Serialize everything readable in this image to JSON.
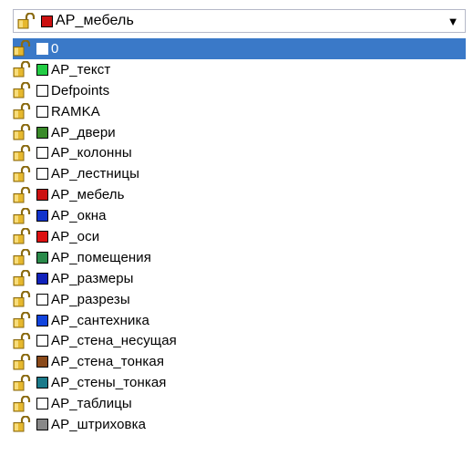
{
  "combo": {
    "selected_label": "AP_мебель",
    "selected_color": "#cc1111",
    "arrow_glyph": "▼"
  },
  "layers": [
    {
      "label": "0",
      "color": "#ffffff",
      "selected": true
    },
    {
      "label": "AP_текст",
      "color": "#22cc44"
    },
    {
      "label": "Defpoints",
      "color": "#ffffff"
    },
    {
      "label": "RAMKA",
      "color": "#ffffff"
    },
    {
      "label": "AP_двери",
      "color": "#3a8a2a"
    },
    {
      "label": "AP_колонны",
      "color": "#ffffff"
    },
    {
      "label": "AP_лестницы",
      "color": "#ffffff"
    },
    {
      "label": "AP_мебель",
      "color": "#cc1111"
    },
    {
      "label": "AP_окна",
      "color": "#1133cc"
    },
    {
      "label": "AP_оси",
      "color": "#dd1111"
    },
    {
      "label": "AP_помещения",
      "color": "#2a8a4a"
    },
    {
      "label": "AP_размеры",
      "color": "#1122bb"
    },
    {
      "label": "AP_разрезы",
      "color": "#ffffff"
    },
    {
      "label": "AP_сантехника",
      "color": "#1144dd"
    },
    {
      "label": "AP_стена_несущая",
      "color": "#ffffff"
    },
    {
      "label": "AP_стена_тонкая",
      "color": "#8a4a1a"
    },
    {
      "label": "AP_стены_тонкая",
      "color": "#1a7a8a"
    },
    {
      "label": "AP_таблицы",
      "color": "#ffffff"
    },
    {
      "label": "AP_штриховка",
      "color": "#888888"
    }
  ],
  "icons": {
    "layer_state": "unlocked-padlock-icon",
    "dropdown": "chevron-down-icon"
  }
}
